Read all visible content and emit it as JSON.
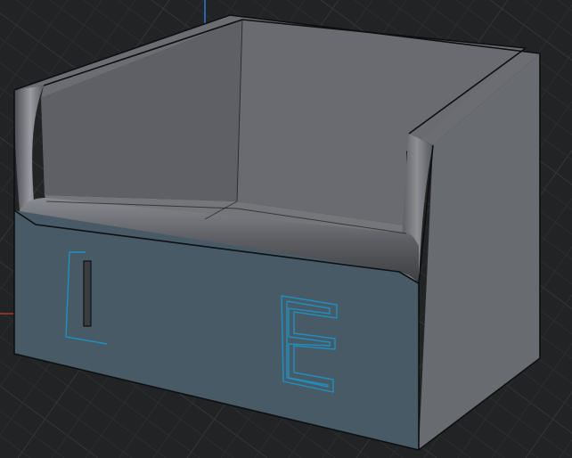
{
  "viewport": {
    "background": "#222324",
    "grid_minor_color": "#2c2e30",
    "grid_major_color": "#34373a"
  },
  "axes": {
    "vertical_axis_color": "#2f78d6",
    "horizontal_axis_color": "#b8322d"
  },
  "model": {
    "object": "open-top box",
    "colors": {
      "front_face": "#475a66",
      "right_face": "#686b70",
      "top_rim": "#6c6d72",
      "inner_back_wall": "#6a6b70",
      "inner_left_wall": "#5f6065",
      "inner_floor": "#757679",
      "edge_outline": "#0e0f10",
      "selected_sketch": "#1f8fc0"
    },
    "front_sketch_glyphs": [
      "I",
      "E"
    ]
  }
}
